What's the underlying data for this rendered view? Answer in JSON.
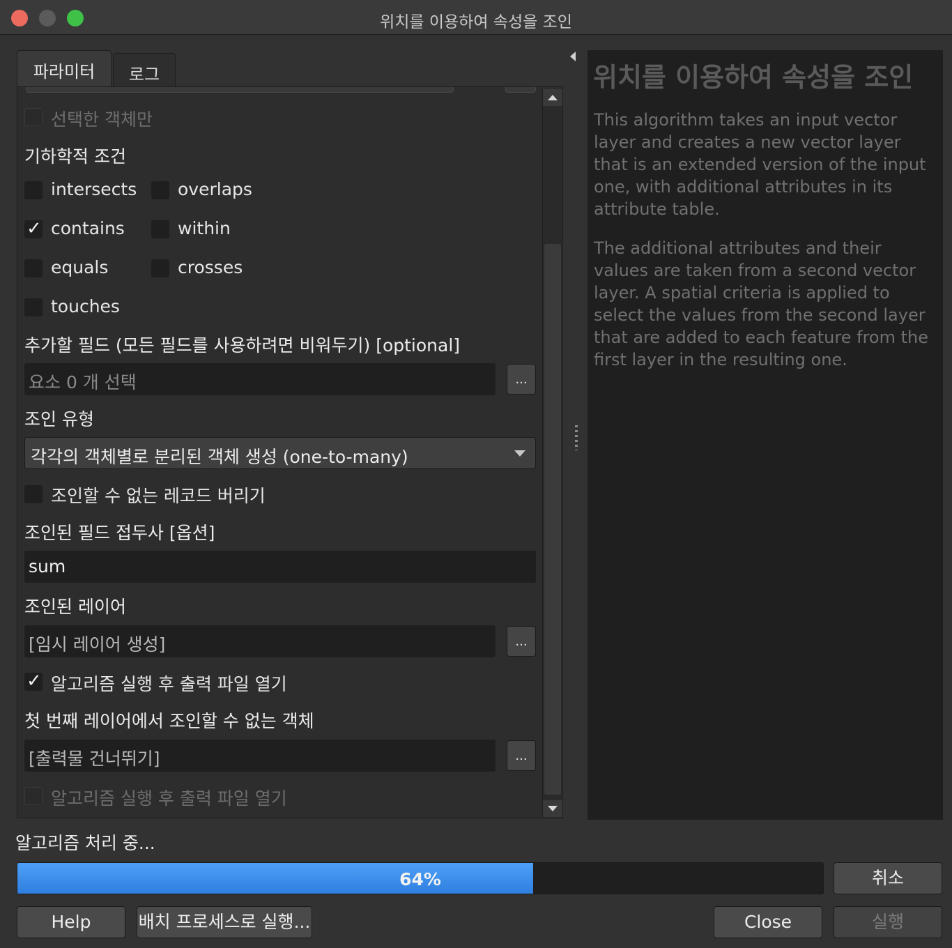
{
  "window": {
    "title": "위치를 이용하여 속성을 조인"
  },
  "tabs": [
    {
      "label": "파라미터"
    },
    {
      "label": "로그"
    }
  ],
  "params": {
    "selected_only": {
      "label": "선택한 객체만",
      "checked": false,
      "enabled": false
    },
    "geometric_predicate": {
      "label": "기하학적 조건",
      "options": [
        {
          "label": "intersects",
          "checked": false
        },
        {
          "label": "overlaps",
          "checked": false
        },
        {
          "label": "contains",
          "checked": true
        },
        {
          "label": "within",
          "checked": false
        },
        {
          "label": "equals",
          "checked": false
        },
        {
          "label": "crosses",
          "checked": false
        },
        {
          "label": "touches",
          "checked": false
        }
      ]
    },
    "fields_to_add": {
      "label": "추가할 필드 (모든 필드를 사용하려면 비워두기) [optional]",
      "value": "요소 0 개 선택",
      "button": "..."
    },
    "join_type": {
      "label": "조인 유형",
      "value": "각각의 객체별로 분리된 객체 생성 (one-to-many)"
    },
    "discard_nonmatching": {
      "label": "조인할 수 없는 레코드 버리기",
      "checked": false
    },
    "prefix": {
      "label": "조인된 필드 접두사 [옵션]",
      "value": "sum"
    },
    "joined_layer": {
      "label": "조인된 레이어",
      "value": "[임시 레이어 생성]",
      "button": "..."
    },
    "open_after_1": {
      "label": "알고리즘 실행 후 출력 파일 열기",
      "checked": true
    },
    "non_joinable": {
      "label": "첫 번째 레이어에서 조인할 수 없는 객체",
      "value": "[출력물 건너뛰기]",
      "button": "..."
    },
    "open_after_2": {
      "label": "알고리즘 실행 후 출력 파일 열기",
      "checked": false,
      "enabled": false
    }
  },
  "help": {
    "title": "위치를 이용하여 속성을 조인",
    "paragraphs": [
      "This algorithm takes an input vector layer and creates a new vector layer that is an extended version of the input one, with additional attributes in its attribute table.",
      "The additional attributes and their values are taken from a second vector layer. A spatial criteria is applied to select the values from the second layer that are added to each feature from the first layer in the resulting one."
    ]
  },
  "status": {
    "text": "알고리즘 처리 중..."
  },
  "progress": {
    "value": 0.64,
    "label": "64%"
  },
  "buttons": {
    "cancel": "취소",
    "help": "Help",
    "batch": "배치 프로세스로 실행...",
    "close": "Close",
    "run": "실행"
  },
  "colors": {
    "accent": "#3a8cf0",
    "background": "#323232",
    "field": "#1f1f1f"
  }
}
